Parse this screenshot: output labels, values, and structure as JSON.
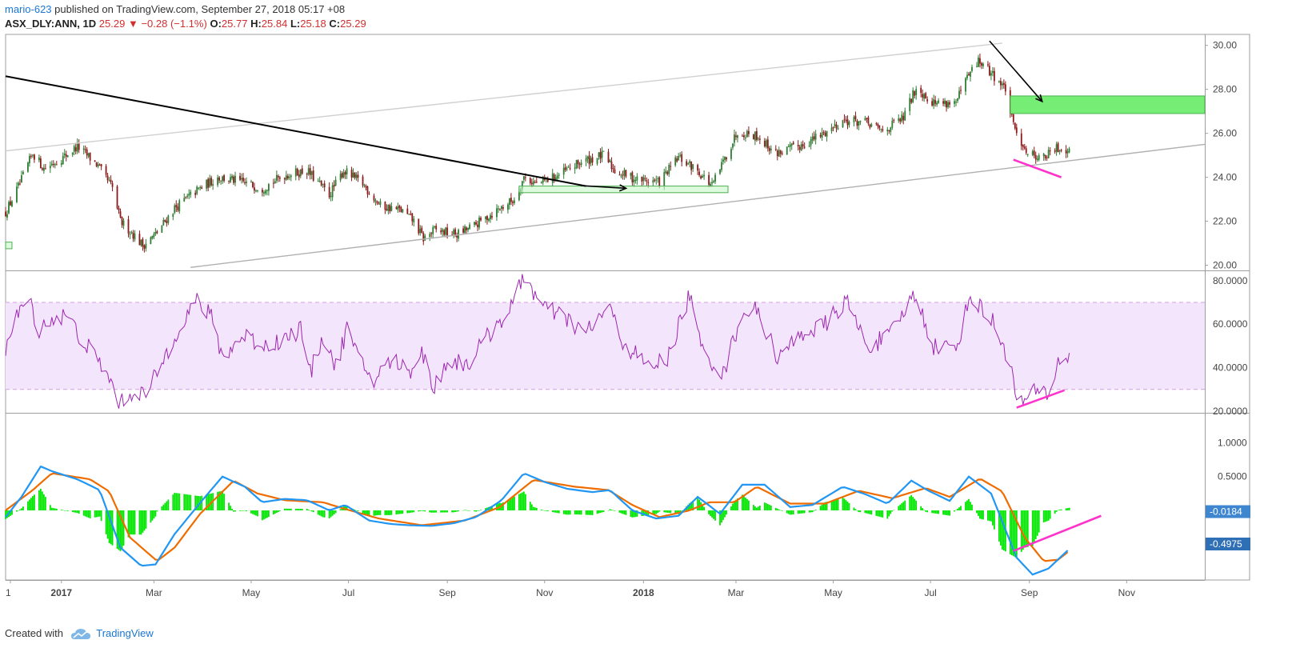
{
  "header": {
    "author": "mario-623",
    "published_text": "published on TradingView.com, September 27, 2018 05:17 +08",
    "symbol_line": "ASX_DLY:ANN, 1D",
    "last_price": "25.29",
    "change_arrow": "▼",
    "change_text": "−0.28 (−1.1%)",
    "open_label": "O:",
    "open_value": "25.77",
    "high_label": "H:",
    "high_value": "25.84",
    "low_label": "L:",
    "low_value": "25.18",
    "close_label": "C:",
    "close_value": "25.29"
  },
  "footer": {
    "created_with": "Created with",
    "brand": "TradingView"
  },
  "colors": {
    "candle_up": "#2e7d32",
    "candle_down": "#8b1a1a",
    "rsi_line": "#9c27b0",
    "rsi_band": "#f3e5fb",
    "macd_line": "#2196f3",
    "signal_line": "#ef6c00",
    "histogram": "#00e600",
    "zone_fill": "#76ee76",
    "divergence": "#ff33cc",
    "channel": "#bdbdbd",
    "trendline": "#000000"
  },
  "chart_data": [
    {
      "type": "candlestick",
      "title": "ASX_DLY:ANN, 1D",
      "x_ticks": [
        "1",
        "2017",
        "Mar",
        "May",
        "Jul",
        "Sep",
        "Nov",
        "2018",
        "Mar",
        "May",
        "Jul",
        "Sep",
        "Nov"
      ],
      "y_ticks": [
        "30.00",
        "28.00",
        "26.00",
        "24.00",
        "22.00",
        "20.00"
      ],
      "ylim": [
        19.8,
        30.5
      ],
      "x_range": [
        "2016-11-28",
        "2018-12-20"
      ],
      "price_path": [
        [
          "2016-11-28",
          22.4
        ],
        [
          "2016-12-07",
          23.7
        ],
        [
          "2016-12-15",
          25.1
        ],
        [
          "2016-12-22",
          24.4
        ],
        [
          "2017-01-03",
          24.9
        ],
        [
          "2017-01-12",
          25.4
        ],
        [
          "2017-01-24",
          24.6
        ],
        [
          "2017-02-03",
          23.5
        ],
        [
          "2017-02-08",
          22.0
        ],
        [
          "2017-02-15",
          21.5
        ],
        [
          "2017-02-22",
          20.9
        ],
        [
          "2017-03-02",
          21.4
        ],
        [
          "2017-03-14",
          22.6
        ],
        [
          "2017-03-28",
          23.4
        ],
        [
          "2017-04-10",
          24.0
        ],
        [
          "2017-04-24",
          23.8
        ],
        [
          "2017-05-08",
          23.5
        ],
        [
          "2017-05-22",
          24.1
        ],
        [
          "2017-06-05",
          24.3
        ],
        [
          "2017-06-19",
          23.2
        ],
        [
          "2017-06-28",
          24.3
        ],
        [
          "2017-07-10",
          23.7
        ],
        [
          "2017-07-21",
          22.7
        ],
        [
          "2017-08-03",
          22.5
        ],
        [
          "2017-08-11",
          22.0
        ],
        [
          "2017-08-17",
          21.2
        ],
        [
          "2017-08-24",
          21.6
        ],
        [
          "2017-09-07",
          21.4
        ],
        [
          "2017-09-18",
          21.8
        ],
        [
          "2017-10-02",
          22.5
        ],
        [
          "2017-10-13",
          23.0
        ],
        [
          "2017-10-19",
          24.0
        ],
        [
          "2017-10-27",
          23.7
        ],
        [
          "2017-11-10",
          24.1
        ],
        [
          "2017-11-24",
          24.7
        ],
        [
          "2017-12-08",
          25.0
        ],
        [
          "2017-12-15",
          24.3
        ],
        [
          "2017-12-29",
          23.9
        ],
        [
          "2018-01-12",
          23.8
        ],
        [
          "2018-01-24",
          24.9
        ],
        [
          "2018-02-05",
          24.3
        ],
        [
          "2018-02-14",
          23.6
        ],
        [
          "2018-02-21",
          24.7
        ],
        [
          "2018-03-02",
          26.1
        ],
        [
          "2018-03-14",
          25.9
        ],
        [
          "2018-03-26",
          25.1
        ],
        [
          "2018-04-09",
          25.4
        ],
        [
          "2018-04-23",
          25.9
        ],
        [
          "2018-05-07",
          26.6
        ],
        [
          "2018-05-21",
          26.5
        ],
        [
          "2018-06-01",
          26.1
        ],
        [
          "2018-06-14",
          26.7
        ],
        [
          "2018-06-22",
          28.1
        ],
        [
          "2018-07-03",
          27.4
        ],
        [
          "2018-07-17",
          27.4
        ],
        [
          "2018-07-24",
          28.5
        ],
        [
          "2018-07-31",
          29.3
        ],
        [
          "2018-08-10",
          28.6
        ],
        [
          "2018-08-17",
          28.0
        ],
        [
          "2018-08-22",
          26.3
        ],
        [
          "2018-08-31",
          25.1
        ],
        [
          "2018-09-10",
          24.9
        ],
        [
          "2018-09-18",
          25.3
        ],
        [
          "2018-09-26",
          25.3
        ]
      ],
      "annotations": {
        "green_zone": {
          "x": [
            "2018-08-20",
            "2018-12-20"
          ],
          "y": [
            26.9,
            27.7
          ]
        },
        "small_box_1": {
          "x": [
            "2017-10-16",
            "2018-02-24"
          ],
          "y": [
            23.3,
            23.6
          ]
        },
        "small_box_2": {
          "x": [
            "2016-11-28",
            "2016-12-02"
          ],
          "y": [
            20.75,
            21.05
          ]
        },
        "downtrend_line": {
          "start": [
            "2016-11-28",
            28.6
          ],
          "end": [
            "2017-11-27",
            23.6
          ]
        },
        "channel_upper": {
          "start": [
            "2016-11-28",
            25.2
          ],
          "end": [
            "2018-08-15",
            30.1
          ]
        },
        "channel_lower": {
          "start": [
            "2017-03-24",
            19.9
          ],
          "end": [
            "2018-12-20",
            25.5
          ]
        },
        "projection_arrow": {
          "start": [
            "2018-08-07",
            30.2
          ],
          "end": [
            "2018-09-09",
            27.45
          ]
        },
        "price_divergence": {
          "start": [
            "2018-08-22",
            24.8
          ],
          "end": [
            "2018-09-21",
            24.0
          ]
        }
      }
    },
    {
      "type": "line",
      "title": "",
      "y_ticks": [
        "80.0000",
        "60.0000",
        "40.0000",
        "20.0000"
      ],
      "ylim": [
        19.6,
        84
      ],
      "band": [
        30,
        70
      ],
      "series": [
        {
          "values": [
            [
              "2016-11-28",
              49
            ],
            [
              "2016-12-05",
              63
            ],
            [
              "2016-12-12",
              72
            ],
            [
              "2016-12-19",
              58
            ],
            [
              "2016-12-26",
              62
            ],
            [
              "2017-01-05",
              64
            ],
            [
              "2017-01-16",
              52
            ],
            [
              "2017-01-30",
              38
            ],
            [
              "2017-02-08",
              23
            ],
            [
              "2017-02-17",
              30
            ],
            [
              "2017-02-24",
              27
            ],
            [
              "2017-03-06",
              42
            ],
            [
              "2017-03-16",
              58
            ],
            [
              "2017-03-28",
              71
            ],
            [
              "2017-04-06",
              63
            ],
            [
              "2017-04-13",
              45
            ],
            [
              "2017-04-27",
              55
            ],
            [
              "2017-05-08",
              50
            ],
            [
              "2017-05-22",
              53
            ],
            [
              "2017-06-01",
              58
            ],
            [
              "2017-06-07",
              37
            ],
            [
              "2017-06-15",
              55
            ],
            [
              "2017-06-23",
              40
            ],
            [
              "2017-06-30",
              58
            ],
            [
              "2017-07-07",
              44
            ],
            [
              "2017-07-17",
              34
            ],
            [
              "2017-07-28",
              44
            ],
            [
              "2017-08-08",
              38
            ],
            [
              "2017-08-16",
              48
            ],
            [
              "2017-08-23",
              30
            ],
            [
              "2017-09-01",
              43
            ],
            [
              "2017-09-14",
              42
            ],
            [
              "2017-10-02",
              60
            ],
            [
              "2017-10-12",
              68
            ],
            [
              "2017-10-19",
              83
            ],
            [
              "2017-10-30",
              68
            ],
            [
              "2017-11-13",
              63
            ],
            [
              "2017-11-27",
              56
            ],
            [
              "2017-12-11",
              68
            ],
            [
              "2017-12-20",
              52
            ],
            [
              "2018-01-05",
              40
            ],
            [
              "2018-01-17",
              44
            ],
            [
              "2018-01-31",
              74
            ],
            [
              "2018-02-07",
              49
            ],
            [
              "2018-02-21",
              37
            ],
            [
              "2018-03-05",
              66
            ],
            [
              "2018-03-14",
              66
            ],
            [
              "2018-03-28",
              44
            ],
            [
              "2018-04-11",
              56
            ],
            [
              "2018-04-25",
              59
            ],
            [
              "2018-05-09",
              71
            ],
            [
              "2018-05-22",
              50
            ],
            [
              "2018-06-05",
              54
            ],
            [
              "2018-06-21",
              74
            ],
            [
              "2018-07-03",
              50
            ],
            [
              "2018-07-17",
              49
            ],
            [
              "2018-07-26",
              73
            ],
            [
              "2018-08-09",
              61
            ],
            [
              "2018-08-20",
              43
            ],
            [
              "2018-08-24",
              23
            ],
            [
              "2018-09-06",
              29
            ],
            [
              "2018-09-13",
              28
            ],
            [
              "2018-09-20",
              44
            ],
            [
              "2018-09-26",
              45
            ]
          ]
        }
      ],
      "annotations": {
        "rsi_divergence": {
          "start": [
            "2018-08-24",
            21.6
          ],
          "end": [
            "2018-09-23",
            29.6
          ]
        }
      }
    },
    {
      "type": "line",
      "title": "",
      "y_ticks": [
        "1.0000",
        "0.5000"
      ],
      "badges": [
        "-0.0184",
        "-0.4975"
      ],
      "ylim": [
        -1.03,
        1.42
      ],
      "series": [
        {
          "role": "macd",
          "values": [
            [
              "2016-11-28",
              -0.1
            ],
            [
              "2016-12-08",
              0.2
            ],
            [
              "2016-12-20",
              0.65
            ],
            [
              "2016-12-27",
              0.58
            ],
            [
              "2017-01-12",
              0.46
            ],
            [
              "2017-01-26",
              0.3
            ],
            [
              "2017-02-08",
              -0.55
            ],
            [
              "2017-02-21",
              -0.82
            ],
            [
              "2017-03-02",
              -0.8
            ],
            [
              "2017-03-14",
              -0.35
            ],
            [
              "2017-03-31",
              0.14
            ],
            [
              "2017-04-13",
              0.5
            ],
            [
              "2017-04-27",
              0.35
            ],
            [
              "2017-05-08",
              0.12
            ],
            [
              "2017-05-22",
              0.17
            ],
            [
              "2017-06-05",
              0.15
            ],
            [
              "2017-06-19",
              0.0
            ],
            [
              "2017-06-29",
              0.08
            ],
            [
              "2017-07-14",
              -0.15
            ],
            [
              "2017-07-27",
              -0.2
            ],
            [
              "2017-08-08",
              -0.22
            ],
            [
              "2017-08-22",
              -0.23
            ],
            [
              "2017-09-05",
              -0.19
            ],
            [
              "2017-09-19",
              -0.1
            ],
            [
              "2017-10-05",
              0.15
            ],
            [
              "2017-10-19",
              0.55
            ],
            [
              "2017-11-01",
              0.42
            ],
            [
              "2017-11-15",
              0.32
            ],
            [
              "2017-12-01",
              0.27
            ],
            [
              "2017-12-12",
              0.3
            ],
            [
              "2017-12-26",
              0.0
            ],
            [
              "2018-01-10",
              -0.12
            ],
            [
              "2018-01-24",
              -0.08
            ],
            [
              "2018-02-05",
              0.2
            ],
            [
              "2018-02-19",
              -0.05
            ],
            [
              "2018-03-05",
              0.38
            ],
            [
              "2018-03-19",
              0.38
            ],
            [
              "2018-04-04",
              0.05
            ],
            [
              "2018-04-18",
              0.08
            ],
            [
              "2018-05-07",
              0.35
            ],
            [
              "2018-05-21",
              0.24
            ],
            [
              "2018-06-04",
              0.1
            ],
            [
              "2018-06-19",
              0.44
            ],
            [
              "2018-06-29",
              0.3
            ],
            [
              "2018-07-13",
              0.14
            ],
            [
              "2018-07-25",
              0.5
            ],
            [
              "2018-08-08",
              0.25
            ],
            [
              "2018-08-24",
              -0.7
            ],
            [
              "2018-09-03",
              -0.95
            ],
            [
              "2018-09-13",
              -0.86
            ],
            [
              "2018-09-26",
              -0.57
            ]
          ]
        },
        {
          "role": "signal",
          "values": [
            [
              "2016-11-28",
              0.0
            ],
            [
              "2016-12-15",
              0.3
            ],
            [
              "2016-12-27",
              0.55
            ],
            [
              "2017-01-20",
              0.46
            ],
            [
              "2017-02-01",
              0.28
            ],
            [
              "2017-02-14",
              -0.4
            ],
            [
              "2017-03-03",
              -0.75
            ],
            [
              "2017-03-14",
              -0.55
            ],
            [
              "2017-03-30",
              -0.05
            ],
            [
              "2017-04-20",
              0.44
            ],
            [
              "2017-05-05",
              0.25
            ],
            [
              "2017-05-22",
              0.15
            ],
            [
              "2017-06-15",
              0.12
            ],
            [
              "2017-06-29",
              0.02
            ],
            [
              "2017-07-20",
              -0.12
            ],
            [
              "2017-08-16",
              -0.22
            ],
            [
              "2017-09-12",
              -0.15
            ],
            [
              "2017-10-04",
              0.05
            ],
            [
              "2017-10-25",
              0.45
            ],
            [
              "2017-11-20",
              0.35
            ],
            [
              "2017-12-11",
              0.3
            ],
            [
              "2017-12-26",
              0.08
            ],
            [
              "2018-01-12",
              -0.1
            ],
            [
              "2018-01-31",
              0.0
            ],
            [
              "2018-02-12",
              0.12
            ],
            [
              "2018-02-28",
              0.12
            ],
            [
              "2018-03-14",
              0.35
            ],
            [
              "2018-04-04",
              0.1
            ],
            [
              "2018-04-26",
              0.1
            ],
            [
              "2018-05-17",
              0.29
            ],
            [
              "2018-06-07",
              0.18
            ],
            [
              "2018-06-28",
              0.33
            ],
            [
              "2018-07-13",
              0.2
            ],
            [
              "2018-08-01",
              0.47
            ],
            [
              "2018-08-15",
              0.28
            ],
            [
              "2018-08-29",
              -0.4
            ],
            [
              "2018-09-10",
              -0.75
            ],
            [
              "2018-09-19",
              -0.73
            ],
            [
              "2018-09-26",
              -0.6
            ]
          ]
        }
      ],
      "annotations": {
        "macd_divergence": {
          "start": [
            "2018-08-22",
            -0.6
          ],
          "end": [
            "2018-10-16",
            -0.08
          ]
        }
      }
    }
  ]
}
